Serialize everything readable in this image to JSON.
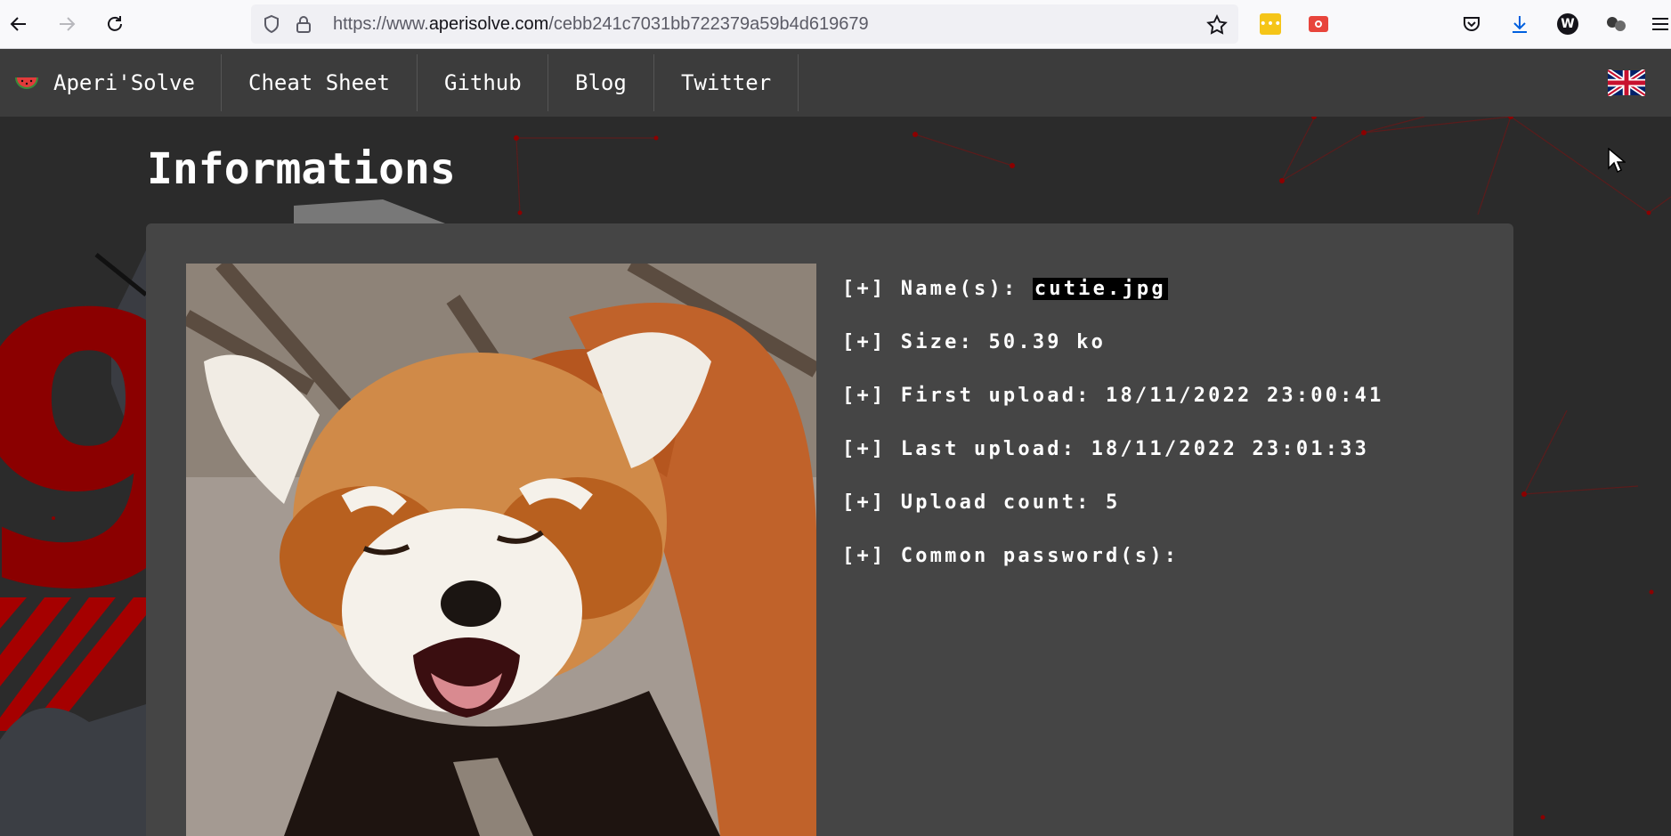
{
  "browser": {
    "url_prefix": "https://www.",
    "url_domain": "aperisolve.com",
    "url_path": "/cebb241c7031bb722379a59b4d619679"
  },
  "navbar": {
    "brand": "Aperi'Solve",
    "links": [
      "Cheat Sheet",
      "Github",
      "Blog",
      "Twitter"
    ]
  },
  "page": {
    "title": "Informations"
  },
  "info": {
    "prefix": "[+]",
    "name_label": "Name(s):",
    "name_value": "cutie.jpg",
    "size_label": "Size:",
    "size_value": "50.39 ko",
    "first_label": "First upload:",
    "first_value": "18/11/2022 23:00:41",
    "last_label": "Last upload:",
    "last_value": "18/11/2022 23:01:33",
    "count_label": "Upload count:",
    "count_value": "5",
    "pass_label": "Common password(s):",
    "pass_value": ""
  },
  "colors": {
    "navbar": "#3c3c3c",
    "background": "#2b2b2b",
    "card": "#454545",
    "accent": "#8b0000"
  }
}
